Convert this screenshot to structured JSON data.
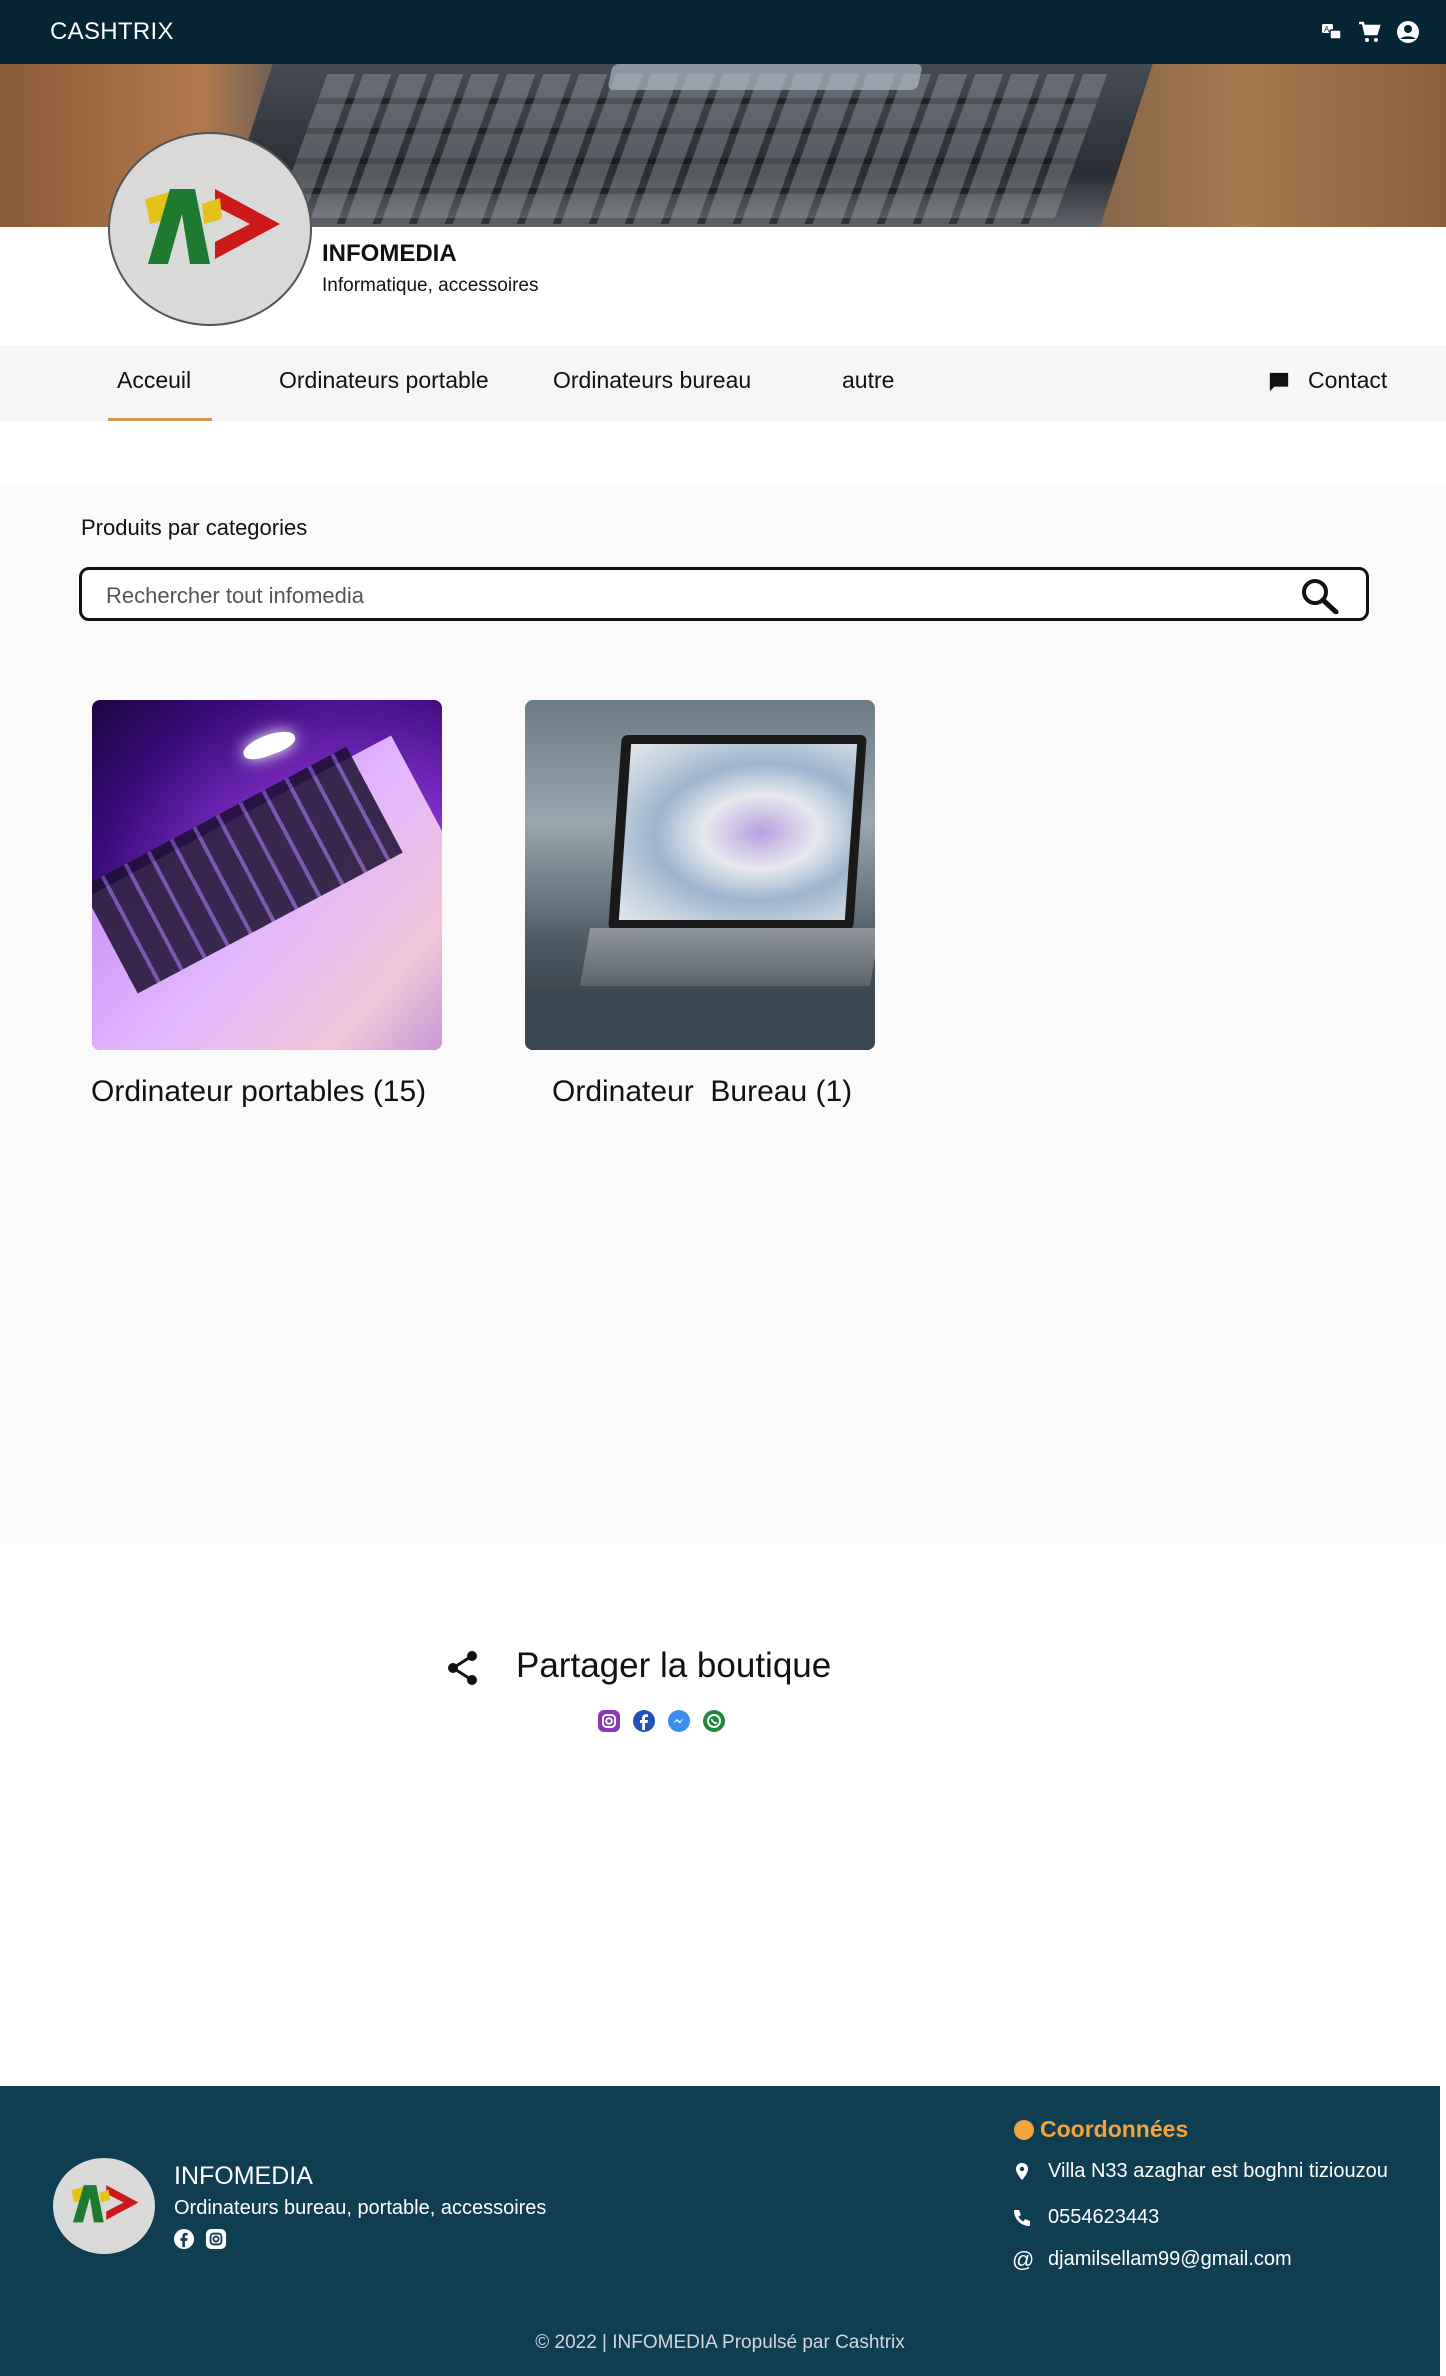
{
  "topbar": {
    "brand": "CASHTRIX",
    "icons": [
      "translate-icon",
      "cart-icon",
      "account-icon"
    ]
  },
  "shop": {
    "name": "INFOMEDIA",
    "subtitle": "Informatique, accessoires"
  },
  "nav": {
    "items": [
      {
        "label": "Acceuil",
        "active": true
      },
      {
        "label": "Ordinateurs portable",
        "active": false
      },
      {
        "label": "Ordinateurs bureau",
        "active": false
      },
      {
        "label": "autre",
        "active": false
      }
    ],
    "contact_label": "Contact",
    "accent_color": "#d29a50"
  },
  "products": {
    "section_title": "Produits par categories",
    "search_placeholder": "Rechercher tout infomedia",
    "categories": [
      {
        "label": "Ordinateur portables (15)"
      },
      {
        "label": "Ordinateur  Bureau (1)"
      }
    ]
  },
  "share": {
    "title": "Partager la boutique",
    "icons": [
      "instagram-icon",
      "facebook-icon",
      "messenger-icon",
      "whatsapp-icon"
    ]
  },
  "footer": {
    "name": "INFOMEDIA",
    "subtitle": "Ordinateurs bureau, portable, accessoires",
    "coord_title": "Coordonnées",
    "address": "Villa N33 azaghar est boghni tiziouzou",
    "phone": "0554623443",
    "email": "djamilsellam99@gmail.com",
    "copyright": "© 2022 | INFOMEDIA Propulsé par Cashtrix",
    "background_color": "#0f3d52",
    "accent_color": "#f2a33a"
  }
}
